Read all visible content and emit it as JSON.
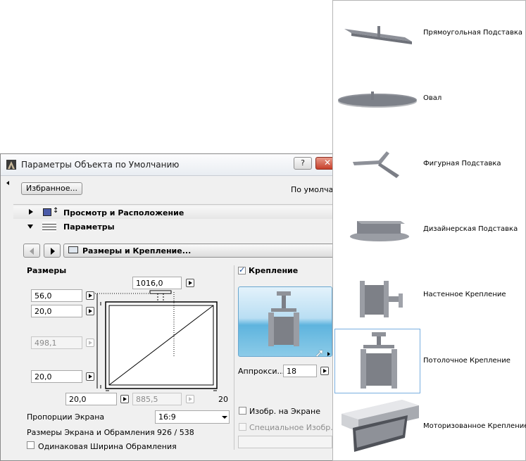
{
  "dialog": {
    "title": "Параметры Объекта по Умолчанию",
    "help_label": "?",
    "favorites_label": "Избранное...",
    "default_label": "По умолчанию",
    "sections": [
      {
        "label": "Просмотр и Расположение",
        "expanded": false
      },
      {
        "label": "Параметры",
        "expanded": true
      }
    ],
    "page_nav": {
      "current_page": "Размеры и Крепление..."
    },
    "sizes": {
      "heading": "Размеры",
      "top_width": "1016,0",
      "top_offset": "56,0",
      "frame_top": "20,0",
      "height": "498,1",
      "frame_bottom": "20,0",
      "frame_left": "20,0",
      "inner_width": "885,5",
      "frame_right": "20",
      "aspect_label": "Пропорции Экрана",
      "aspect_value": "16:9",
      "screen_sizes_label": "Размеры Экрана и Обрамления",
      "screen_sizes_value": "926 / 538",
      "same_frame_label": "Одинаковая Ширина Обрамления"
    },
    "mount": {
      "checkbox_label": "Крепление",
      "checked": true,
      "approx_label": "Аппрокси...",
      "approx_value": "18",
      "screen_image_label": "Изобр. на Экране",
      "special_image_label": "Специальное Изобр."
    }
  },
  "popup": {
    "items": [
      {
        "label": "Прямоугольная Подставка",
        "selected": false
      },
      {
        "label": "Овал",
        "selected": false
      },
      {
        "label": "Фигурная Подставка",
        "selected": false
      },
      {
        "label": "Дизайнерская Подставка",
        "selected": false
      },
      {
        "label": "Настенное Крепление",
        "selected": false
      },
      {
        "label": "Потолочное Крепление",
        "selected": true
      },
      {
        "label": "Моторизованное Крепление",
        "selected": false
      }
    ]
  }
}
